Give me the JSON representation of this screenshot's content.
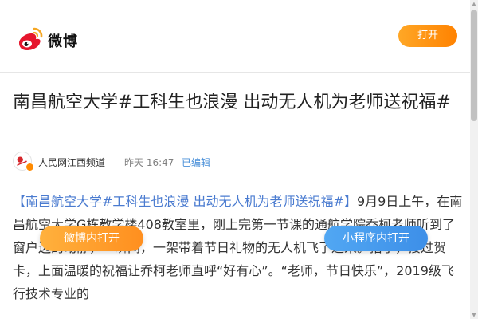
{
  "header": {
    "logo_icon": "weibo-logo-icon",
    "logo_text": "微博",
    "open_label": "打开"
  },
  "article": {
    "title": "南昌航空大学#工科生也浪漫 出动无人机为老师送祝福#",
    "author": "人民网江西频道",
    "time": "昨天 16:47",
    "edited": "已编辑",
    "body": {
      "open_bracket": "【南昌航空大学",
      "hashtag": "#工科生也浪漫 出动无人机为老师送祝福#",
      "close_bracket": "】",
      "text": "9月9日上午，在南昌航空大学G栋教学楼408教室里，刚上完第一节课的通航学院乔柯老师听到了窗户边的动静，一瞬间，一架带着节日礼物的无人机飞了进来。抬手，接过贺卡，上面温暖的祝福让乔柯老师直呼“好有心”。“老师，节日快乐”，2019级飞行技术专业的"
    }
  },
  "floating": {
    "weibo_label": "微博内打开",
    "mini_label": "小程序内打开"
  },
  "colors": {
    "accent_orange": "#ff8200",
    "link_blue": "#4a7bd0",
    "mini_blue": "#3d8fe8"
  }
}
